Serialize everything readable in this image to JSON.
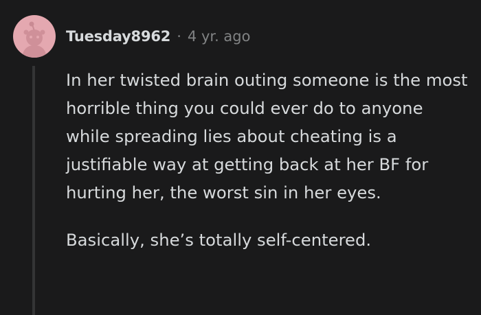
{
  "comment": {
    "author": "Tuesday8962",
    "separator": "·",
    "timestamp": "4 yr. ago",
    "avatar_icon": "reddit-snoo-avatar-icon",
    "avatar_color": "#e4a8b0",
    "paragraphs": [
      "In her twisted brain outing someone is the most horrible thing you could ever do to anyone while spreading lies about cheating is a justifiable way at getting back at her BF for hurting her, the worst sin in her eyes.",
      "Basically, she’s totally self-centered."
    ]
  }
}
